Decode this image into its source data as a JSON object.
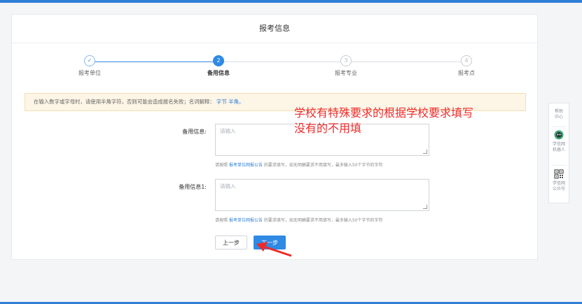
{
  "page": {
    "title": "报考信息"
  },
  "steps": [
    {
      "number": "✓",
      "label": "报考单位",
      "state": "done"
    },
    {
      "number": "2",
      "label": "备用信息",
      "state": "active"
    },
    {
      "number": "3",
      "label": "报考专业",
      "state": "pending"
    },
    {
      "number": "4",
      "label": "报考点",
      "state": "pending"
    }
  ],
  "notice": {
    "text": "在输入数字或字母时，请使用半角字符，否则可能会造成报名失败；名词解释：",
    "link1": "字节",
    "link2": "半角。"
  },
  "annotation": {
    "line1": "学校有特殊要求的根据学校要求填写",
    "line2": "没有的不用填",
    "color": "#ee2b2b"
  },
  "form": {
    "field1": {
      "label": "备用信息:",
      "placeholder": "请输入",
      "hint_prefix": "请按照",
      "hint_link": "报考单位网报公告",
      "hint_suffix": "的要求填写，如无明确要求不用填写，最多输入50个字节的字符"
    },
    "field2": {
      "label": "备用信息1:",
      "placeholder": "请输入",
      "hint_prefix": "请按照",
      "hint_link": "报考单位网报公告",
      "hint_suffix": "的要求填写，如无明确要求不用填写，最多输入50个字节的字符"
    },
    "prev_label": "上一步",
    "next_label": "下一步"
  },
  "side_panel": {
    "help_line1": "帮助",
    "help_line2": "中心",
    "robot_line1": "学信网",
    "robot_line2": "机器人",
    "wechat_line1": "学信网",
    "wechat_line2": "公众号"
  },
  "colors": {
    "primary": "#2f8ae4",
    "accent_bar": "#2f7fd6",
    "notice_bg": "#fdf5e6"
  }
}
